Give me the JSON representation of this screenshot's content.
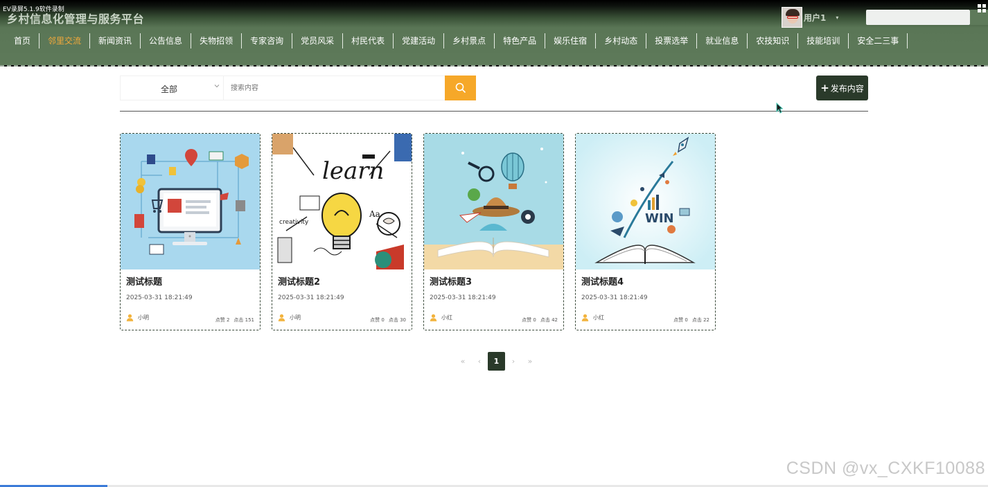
{
  "recorder": {
    "label": "EV录屏5.1.9软件录制"
  },
  "header": {
    "site_title": "乡村信息化管理与服务平台",
    "user_name": "用户1",
    "caret": "▾",
    "menu_icon": "grid-icon"
  },
  "nav": {
    "items": [
      {
        "label": "首页",
        "active": false
      },
      {
        "label": "邻里交流",
        "active": true
      },
      {
        "label": "新闻资讯",
        "active": false
      },
      {
        "label": "公告信息",
        "active": false
      },
      {
        "label": "失物招领",
        "active": false
      },
      {
        "label": "专家咨询",
        "active": false
      },
      {
        "label": "党员风采",
        "active": false
      },
      {
        "label": "村民代表",
        "active": false
      },
      {
        "label": "党建活动",
        "active": false
      },
      {
        "label": "乡村景点",
        "active": false
      },
      {
        "label": "特色产品",
        "active": false
      },
      {
        "label": "娱乐住宿",
        "active": false
      },
      {
        "label": "乡村动态",
        "active": false
      },
      {
        "label": "投票选举",
        "active": false
      },
      {
        "label": "就业信息",
        "active": false
      },
      {
        "label": "农技知识",
        "active": false
      },
      {
        "label": "技能培训",
        "active": false
      },
      {
        "label": "安全二三事",
        "active": false
      }
    ]
  },
  "search": {
    "category_value": "全部",
    "placeholder": "搜索内容",
    "button_icon": "search-icon"
  },
  "publish": {
    "plus": "+",
    "label": "发布内容"
  },
  "cards": [
    {
      "title": "测试标题",
      "date": "2025-03-31 18:21:49",
      "author": "小明",
      "likes": "点赞 2",
      "clicks": "点击 151"
    },
    {
      "title": "测试标题2",
      "date": "2025-03-31 18:21:49",
      "author": "小明",
      "likes": "点赞 0",
      "clicks": "点击 30"
    },
    {
      "title": "测试标题3",
      "date": "2025-03-31 18:21:49",
      "author": "小红",
      "likes": "点赞 0",
      "clicks": "点击 42"
    },
    {
      "title": "测试标题4",
      "date": "2025-03-31 18:21:49",
      "author": "小红",
      "likes": "点赞 0",
      "clicks": "点击 22"
    }
  ],
  "pagination": {
    "first": "«",
    "prev": "‹",
    "current": "1",
    "next": "›",
    "last": "»"
  },
  "watermark": "CSDN @vx_CXKF10088",
  "colors": {
    "nav_active": "#f3a93a",
    "search_button": "#f6a829",
    "dark_green": "#2a3a2a",
    "header_green": "#5e7a5a"
  }
}
